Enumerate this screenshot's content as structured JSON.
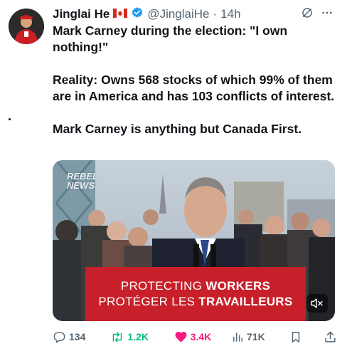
{
  "author": {
    "name": "Jinglai He",
    "flag_icon": "canada-flag-icon",
    "verified_icon": "verified-badge-icon",
    "handle": "@JinglaiHe",
    "separator": "·",
    "time": "14h"
  },
  "tweet": {
    "paragraphs": [
      "Mark Carney during the election: \"I own nothing!\"",
      "Reality: Owns 568 stocks of which 99% of them are in America and has 103 conflicts of interest.",
      "Mark Carney is anything but Canada First."
    ]
  },
  "media": {
    "watermark_line1": "REBEL",
    "watermark_line2": "NEWS",
    "banner_line1_normal": "PROTECTING ",
    "banner_line1_bold": "WORKERS",
    "banner_line2_normal": "PROTÉGER LES ",
    "banner_line2_bold": "TRAVAILLEURS",
    "mute_icon": "muted-speaker-icon"
  },
  "actions": {
    "replies": "134",
    "reposts": "1.2K",
    "likes": "3.4K",
    "views": "71K"
  },
  "colors": {
    "text": "#0f1419",
    "secondary": "#536471",
    "verified": "#1d9bf0",
    "repost": "#00ba7c",
    "like": "#f91880",
    "banner": "#c8202a"
  }
}
